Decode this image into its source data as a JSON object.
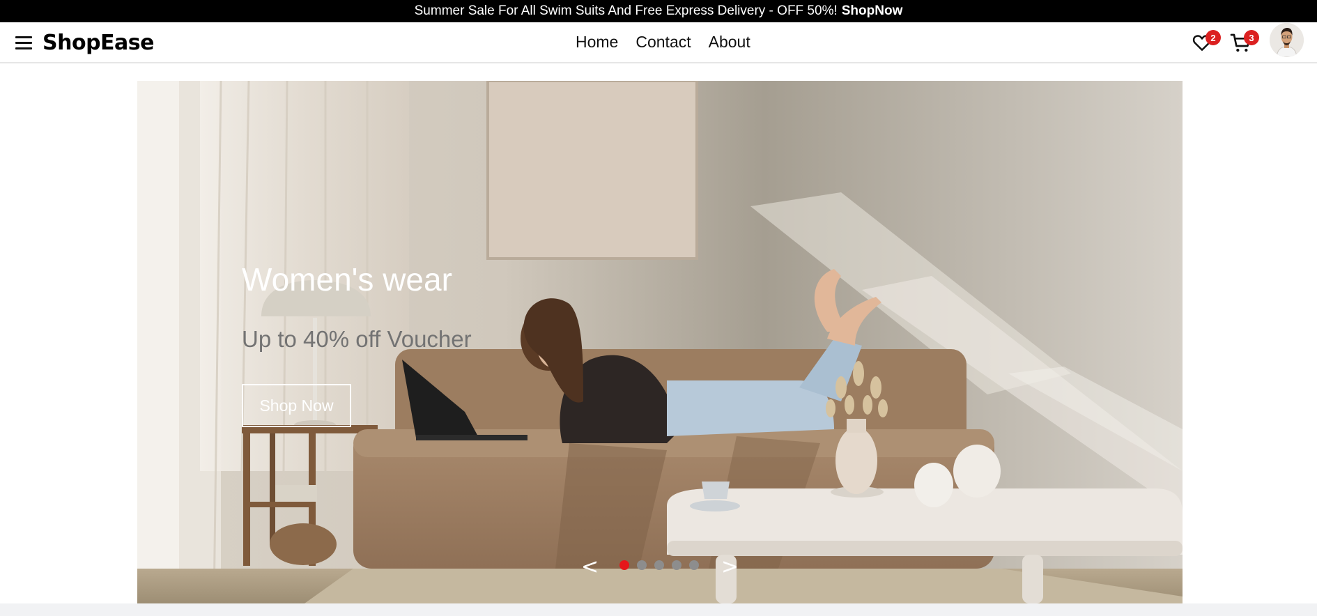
{
  "announcement": {
    "text": "Summer Sale For All Swim Suits And Free Express Delivery - OFF 50%!",
    "link": "ShopNow"
  },
  "navbar": {
    "brand": "ShopEase",
    "menu": [
      {
        "label": "Home"
      },
      {
        "label": "Contact"
      },
      {
        "label": "About"
      }
    ],
    "wishlist_count": "2",
    "cart_count": "3"
  },
  "hero": {
    "title": "Women's wear",
    "subtitle": "Up to 40% off Voucher",
    "button_label": "Shop Now",
    "prev_symbol": "<",
    "next_symbol": ">",
    "slide_count": 5,
    "active_slide": 1
  },
  "colors": {
    "accent": "#e5161b",
    "badge": "#db2020",
    "topbar": "#000000"
  },
  "icons": {
    "menu": "hamburger-icon",
    "wishlist": "heart-icon",
    "cart": "cart-icon"
  }
}
